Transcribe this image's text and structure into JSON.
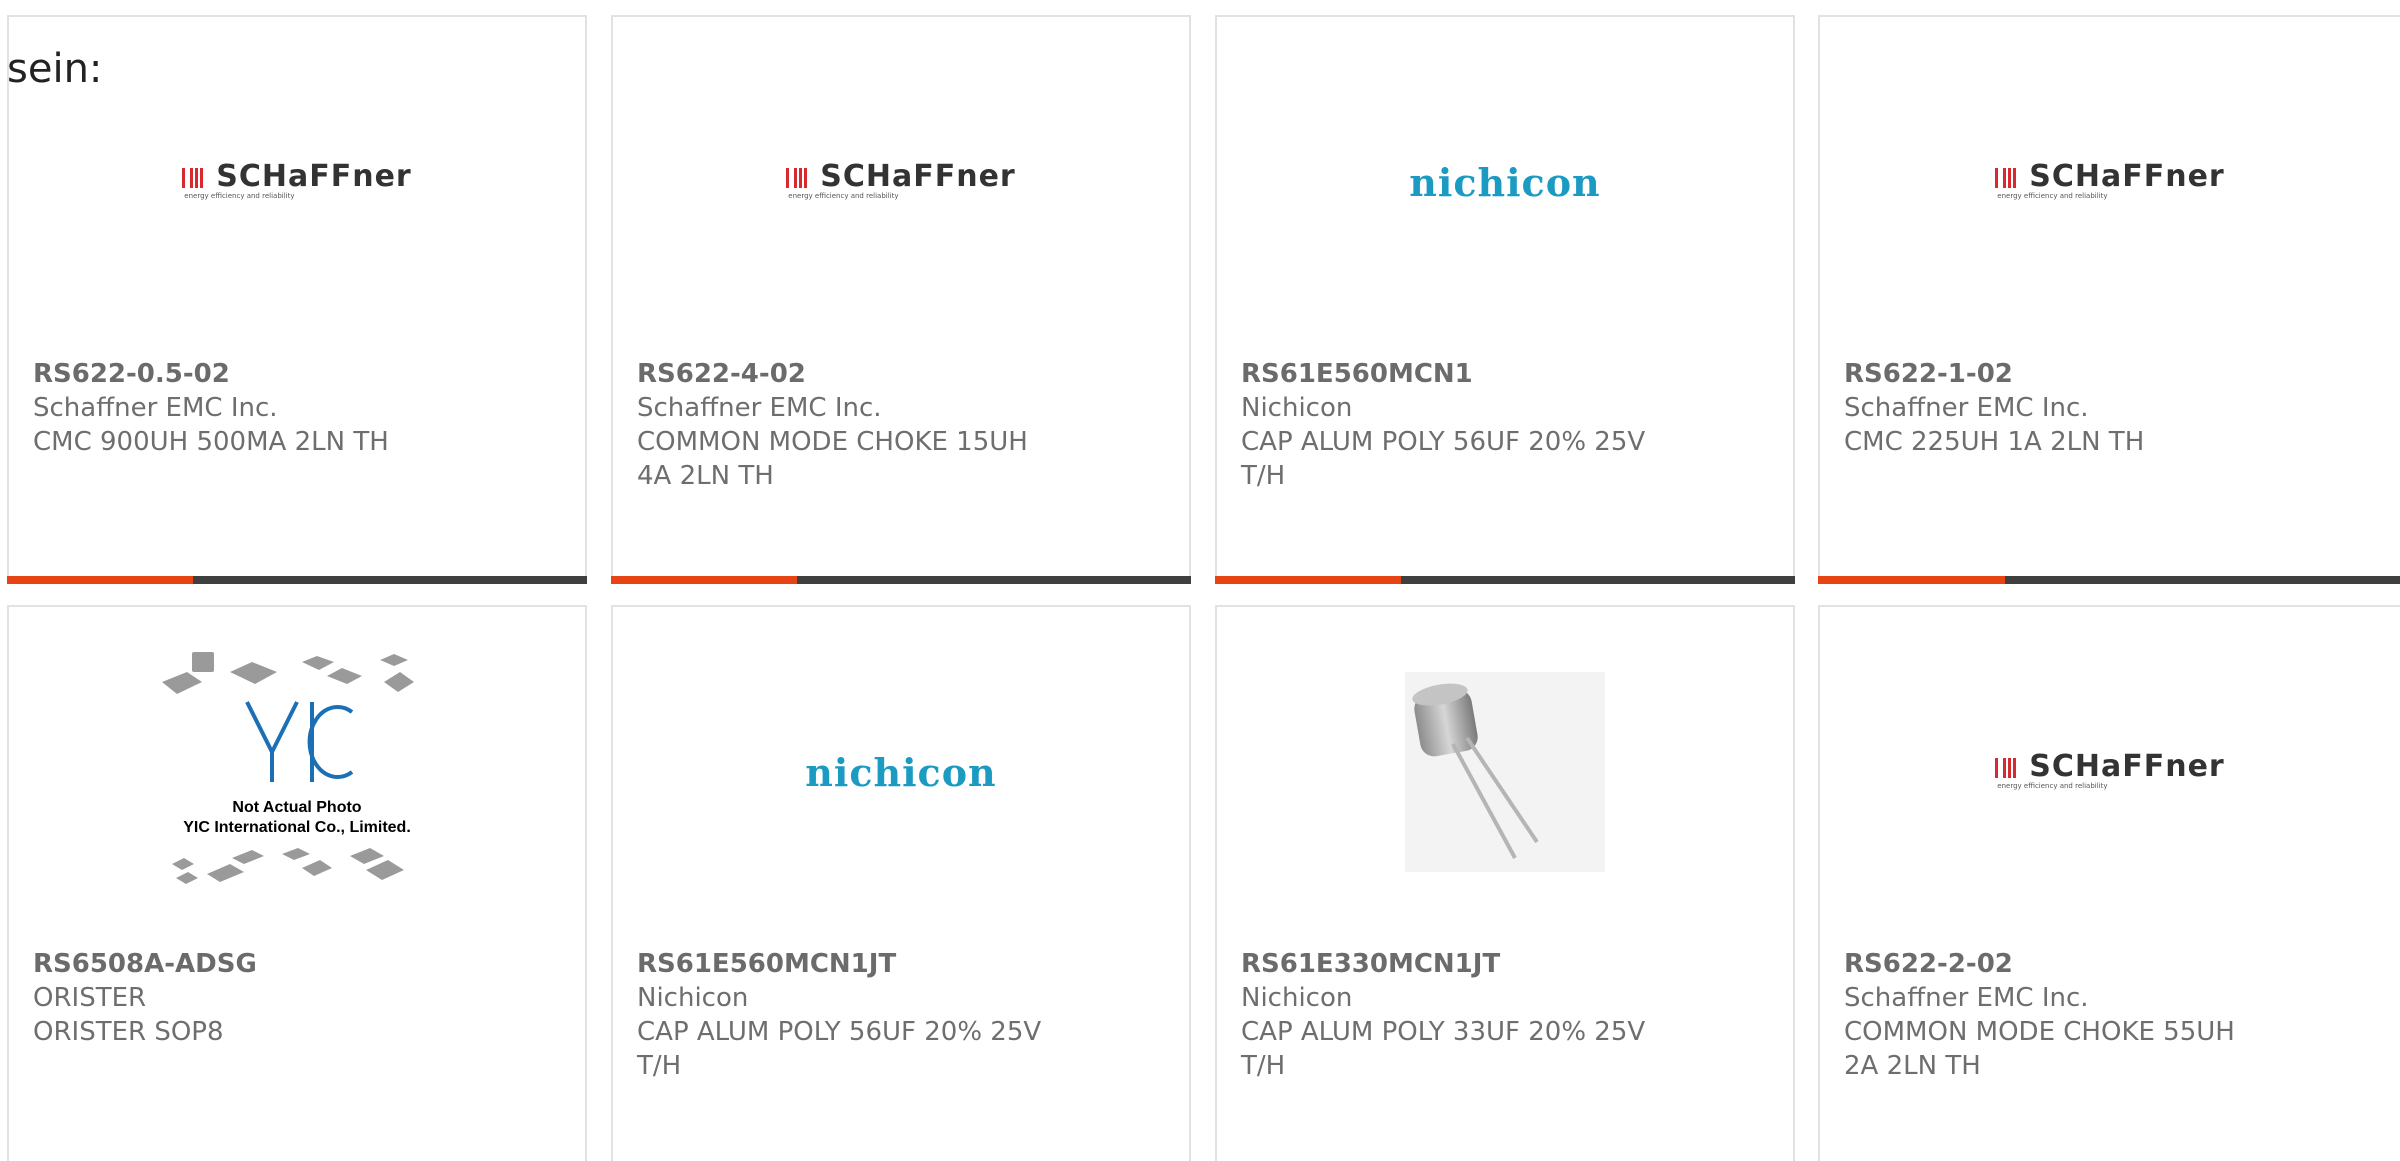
{
  "prompt_text": "sein:",
  "colors": {
    "accent": "#e64415",
    "bar": "#3f3f3f",
    "nichicon": "#1b9ac2",
    "schaffner_red": "#d8292f"
  },
  "logos": {
    "schaffner_word": "SCHaFFner",
    "schaffner_tag": "energy efficiency and reliability",
    "nichicon_word": "nichicon",
    "yic_line1": "Not Actual Photo",
    "yic_line2": "YIC International Co., Limited."
  },
  "cards": [
    {
      "part": "RS622-0.5-02",
      "maker": "Schaffner EMC Inc.",
      "desc": "CMC 900UH 500MA 2LN TH",
      "image": "schaffner-logo",
      "progress": 0.32
    },
    {
      "part": "RS622-4-02",
      "maker": "Schaffner EMC Inc.",
      "desc": "COMMON MODE CHOKE 15UH 4A 2LN TH",
      "image": "schaffner-logo",
      "progress": 0.32
    },
    {
      "part": "RS61E560MCN1",
      "maker": "Nichicon",
      "desc": "CAP ALUM POLY 56UF 20% 25V T/H",
      "image": "nichicon-logo",
      "progress": 0.32
    },
    {
      "part": "RS622-1-02",
      "maker": "Schaffner EMC Inc.",
      "desc": "CMC 225UH 1A 2LN TH",
      "image": "schaffner-logo",
      "progress": 0.32
    },
    {
      "part": "RS6508A-ADSG",
      "maker": "ORISTER",
      "desc": "ORISTER SOP8",
      "image": "yic-placeholder"
    },
    {
      "part": "RS61E560MCN1JT",
      "maker": "Nichicon",
      "desc": "CAP ALUM POLY 56UF 20% 25V T/H",
      "image": "nichicon-logo"
    },
    {
      "part": "RS61E330MCN1JT",
      "maker": "Nichicon",
      "desc": "CAP ALUM POLY 33UF 20% 25V T/H",
      "image": "capacitor-photo"
    },
    {
      "part": "RS622-2-02",
      "maker": "Schaffner EMC Inc.",
      "desc": "COMMON MODE CHOKE 55UH 2A 2LN TH",
      "image": "schaffner-logo"
    }
  ]
}
